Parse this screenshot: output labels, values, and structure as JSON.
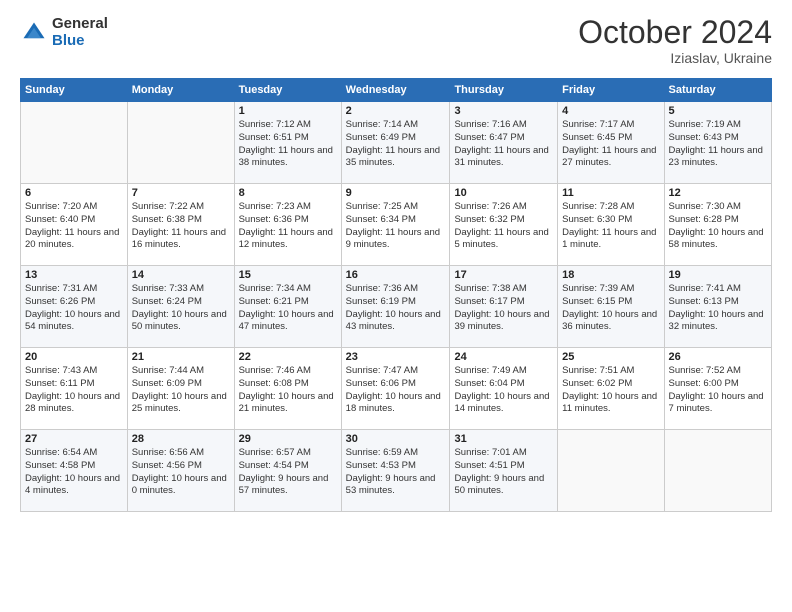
{
  "logo": {
    "general": "General",
    "blue": "Blue"
  },
  "header": {
    "month": "October 2024",
    "location": "Iziaslav, Ukraine"
  },
  "weekdays": [
    "Sunday",
    "Monday",
    "Tuesday",
    "Wednesday",
    "Thursday",
    "Friday",
    "Saturday"
  ],
  "weeks": [
    [
      {
        "day": "",
        "sunrise": "",
        "sunset": "",
        "daylight": ""
      },
      {
        "day": "",
        "sunrise": "",
        "sunset": "",
        "daylight": ""
      },
      {
        "day": "1",
        "sunrise": "Sunrise: 7:12 AM",
        "sunset": "Sunset: 6:51 PM",
        "daylight": "Daylight: 11 hours and 38 minutes."
      },
      {
        "day": "2",
        "sunrise": "Sunrise: 7:14 AM",
        "sunset": "Sunset: 6:49 PM",
        "daylight": "Daylight: 11 hours and 35 minutes."
      },
      {
        "day": "3",
        "sunrise": "Sunrise: 7:16 AM",
        "sunset": "Sunset: 6:47 PM",
        "daylight": "Daylight: 11 hours and 31 minutes."
      },
      {
        "day": "4",
        "sunrise": "Sunrise: 7:17 AM",
        "sunset": "Sunset: 6:45 PM",
        "daylight": "Daylight: 11 hours and 27 minutes."
      },
      {
        "day": "5",
        "sunrise": "Sunrise: 7:19 AM",
        "sunset": "Sunset: 6:43 PM",
        "daylight": "Daylight: 11 hours and 23 minutes."
      }
    ],
    [
      {
        "day": "6",
        "sunrise": "Sunrise: 7:20 AM",
        "sunset": "Sunset: 6:40 PM",
        "daylight": "Daylight: 11 hours and 20 minutes."
      },
      {
        "day": "7",
        "sunrise": "Sunrise: 7:22 AM",
        "sunset": "Sunset: 6:38 PM",
        "daylight": "Daylight: 11 hours and 16 minutes."
      },
      {
        "day": "8",
        "sunrise": "Sunrise: 7:23 AM",
        "sunset": "Sunset: 6:36 PM",
        "daylight": "Daylight: 11 hours and 12 minutes."
      },
      {
        "day": "9",
        "sunrise": "Sunrise: 7:25 AM",
        "sunset": "Sunset: 6:34 PM",
        "daylight": "Daylight: 11 hours and 9 minutes."
      },
      {
        "day": "10",
        "sunrise": "Sunrise: 7:26 AM",
        "sunset": "Sunset: 6:32 PM",
        "daylight": "Daylight: 11 hours and 5 minutes."
      },
      {
        "day": "11",
        "sunrise": "Sunrise: 7:28 AM",
        "sunset": "Sunset: 6:30 PM",
        "daylight": "Daylight: 11 hours and 1 minute."
      },
      {
        "day": "12",
        "sunrise": "Sunrise: 7:30 AM",
        "sunset": "Sunset: 6:28 PM",
        "daylight": "Daylight: 10 hours and 58 minutes."
      }
    ],
    [
      {
        "day": "13",
        "sunrise": "Sunrise: 7:31 AM",
        "sunset": "Sunset: 6:26 PM",
        "daylight": "Daylight: 10 hours and 54 minutes."
      },
      {
        "day": "14",
        "sunrise": "Sunrise: 7:33 AM",
        "sunset": "Sunset: 6:24 PM",
        "daylight": "Daylight: 10 hours and 50 minutes."
      },
      {
        "day": "15",
        "sunrise": "Sunrise: 7:34 AM",
        "sunset": "Sunset: 6:21 PM",
        "daylight": "Daylight: 10 hours and 47 minutes."
      },
      {
        "day": "16",
        "sunrise": "Sunrise: 7:36 AM",
        "sunset": "Sunset: 6:19 PM",
        "daylight": "Daylight: 10 hours and 43 minutes."
      },
      {
        "day": "17",
        "sunrise": "Sunrise: 7:38 AM",
        "sunset": "Sunset: 6:17 PM",
        "daylight": "Daylight: 10 hours and 39 minutes."
      },
      {
        "day": "18",
        "sunrise": "Sunrise: 7:39 AM",
        "sunset": "Sunset: 6:15 PM",
        "daylight": "Daylight: 10 hours and 36 minutes."
      },
      {
        "day": "19",
        "sunrise": "Sunrise: 7:41 AM",
        "sunset": "Sunset: 6:13 PM",
        "daylight": "Daylight: 10 hours and 32 minutes."
      }
    ],
    [
      {
        "day": "20",
        "sunrise": "Sunrise: 7:43 AM",
        "sunset": "Sunset: 6:11 PM",
        "daylight": "Daylight: 10 hours and 28 minutes."
      },
      {
        "day": "21",
        "sunrise": "Sunrise: 7:44 AM",
        "sunset": "Sunset: 6:09 PM",
        "daylight": "Daylight: 10 hours and 25 minutes."
      },
      {
        "day": "22",
        "sunrise": "Sunrise: 7:46 AM",
        "sunset": "Sunset: 6:08 PM",
        "daylight": "Daylight: 10 hours and 21 minutes."
      },
      {
        "day": "23",
        "sunrise": "Sunrise: 7:47 AM",
        "sunset": "Sunset: 6:06 PM",
        "daylight": "Daylight: 10 hours and 18 minutes."
      },
      {
        "day": "24",
        "sunrise": "Sunrise: 7:49 AM",
        "sunset": "Sunset: 6:04 PM",
        "daylight": "Daylight: 10 hours and 14 minutes."
      },
      {
        "day": "25",
        "sunrise": "Sunrise: 7:51 AM",
        "sunset": "Sunset: 6:02 PM",
        "daylight": "Daylight: 10 hours and 11 minutes."
      },
      {
        "day": "26",
        "sunrise": "Sunrise: 7:52 AM",
        "sunset": "Sunset: 6:00 PM",
        "daylight": "Daylight: 10 hours and 7 minutes."
      }
    ],
    [
      {
        "day": "27",
        "sunrise": "Sunrise: 6:54 AM",
        "sunset": "Sunset: 4:58 PM",
        "daylight": "Daylight: 10 hours and 4 minutes."
      },
      {
        "day": "28",
        "sunrise": "Sunrise: 6:56 AM",
        "sunset": "Sunset: 4:56 PM",
        "daylight": "Daylight: 10 hours and 0 minutes."
      },
      {
        "day": "29",
        "sunrise": "Sunrise: 6:57 AM",
        "sunset": "Sunset: 4:54 PM",
        "daylight": "Daylight: 9 hours and 57 minutes."
      },
      {
        "day": "30",
        "sunrise": "Sunrise: 6:59 AM",
        "sunset": "Sunset: 4:53 PM",
        "daylight": "Daylight: 9 hours and 53 minutes."
      },
      {
        "day": "31",
        "sunrise": "Sunrise: 7:01 AM",
        "sunset": "Sunset: 4:51 PM",
        "daylight": "Daylight: 9 hours and 50 minutes."
      },
      {
        "day": "",
        "sunrise": "",
        "sunset": "",
        "daylight": ""
      },
      {
        "day": "",
        "sunrise": "",
        "sunset": "",
        "daylight": ""
      }
    ]
  ]
}
